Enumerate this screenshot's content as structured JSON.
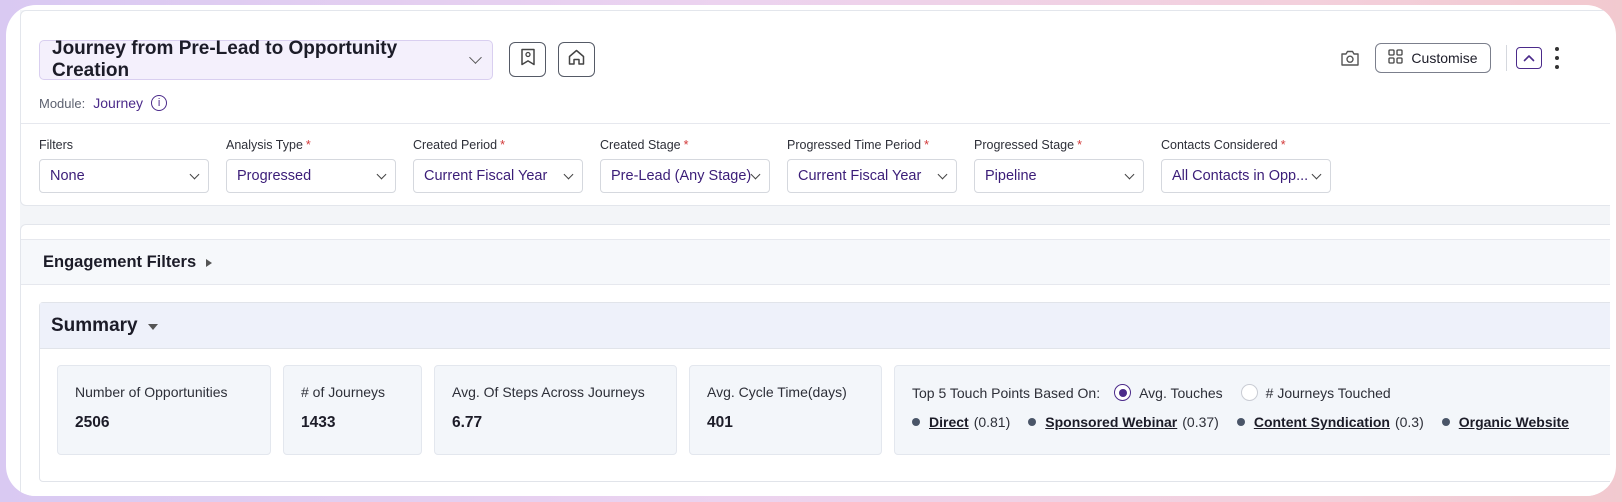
{
  "header": {
    "report_title": "Journey from Pre-Lead to Opportunity Creation",
    "module_label": "Module:",
    "module_value": "Journey",
    "info_glyph": "i",
    "customise_label": "Customise",
    "icons": [
      "bookmark-icon",
      "home-icon",
      "camera-icon",
      "grid-icon",
      "collapse-icon",
      "more-icon"
    ]
  },
  "filters": [
    {
      "label": "Filters",
      "required": false,
      "value": "None"
    },
    {
      "label": "Analysis Type",
      "required": true,
      "value": "Progressed"
    },
    {
      "label": "Created Period",
      "required": true,
      "value": "Current Fiscal Year"
    },
    {
      "label": "Created Stage",
      "required": true,
      "value": "Pre-Lead (Any Stage)"
    },
    {
      "label": "Progressed Time Period",
      "required": true,
      "value": "Current Fiscal Year"
    },
    {
      "label": "Progressed Stage",
      "required": true,
      "value": "Pipeline"
    },
    {
      "label": "Contacts Considered",
      "required": true,
      "value": "All Contacts in Opp..."
    }
  ],
  "required_marker": "*",
  "engagement": {
    "title": "Engagement Filters"
  },
  "summary": {
    "title": "Summary",
    "metrics": [
      {
        "label": "Number of Opportunities",
        "value": "2506"
      },
      {
        "label": "# of Journeys",
        "value": "1433"
      },
      {
        "label": "Avg. Of Steps Across Journeys",
        "value": "6.77"
      },
      {
        "label": "Avg. Cycle Time(days)",
        "value": "401"
      }
    ],
    "touch_points": {
      "label": "Top 5 Touch Points Based On:",
      "option_avg": "Avg. Touches",
      "option_journeys": "# Journeys Touched",
      "selected": "Avg. Touches",
      "items": [
        {
          "name": "Direct",
          "count": "(0.81)"
        },
        {
          "name": "Sponsored Webinar",
          "count": "(0.37)"
        },
        {
          "name": "Content Syndication",
          "count": "(0.3)"
        },
        {
          "name": "Organic Website",
          "count": ""
        }
      ]
    }
  }
}
